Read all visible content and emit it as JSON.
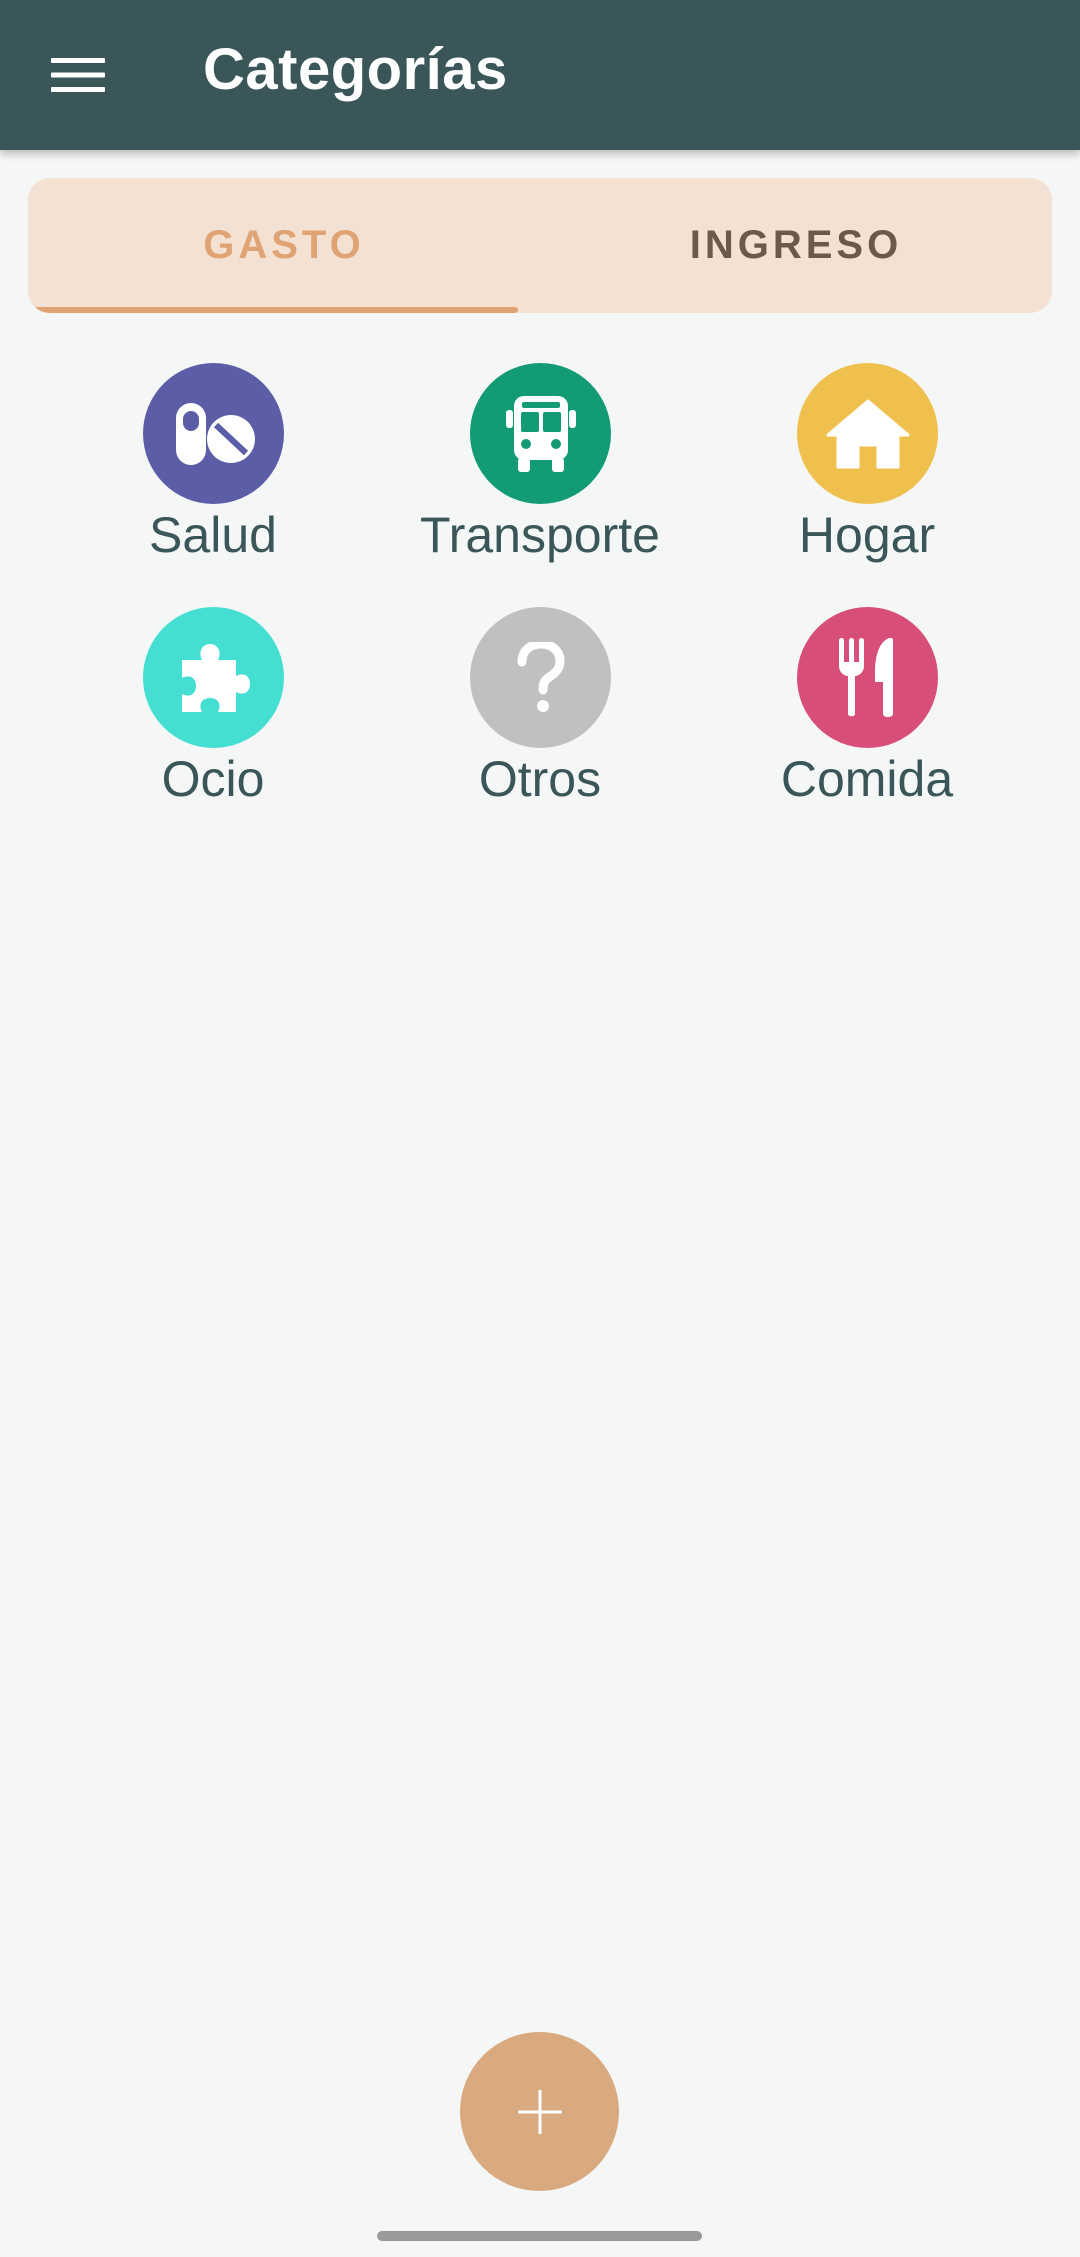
{
  "app_bar": {
    "title": "Categorías",
    "menu_icon": "hamburger-menu-icon",
    "background": "#3a5658"
  },
  "tabs": {
    "items": [
      {
        "label": "GASTO",
        "selected": true,
        "color": "#e0a374"
      },
      {
        "label": "INGRESO",
        "selected": false,
        "color": "#6b5a4c"
      }
    ],
    "background": "#f3e2d3"
  },
  "categories": [
    {
      "label": "Salud",
      "icon": "pills-icon",
      "color": "#5b5ea6"
    },
    {
      "label": "Transporte",
      "icon": "bus-icon",
      "color": "#129b74"
    },
    {
      "label": "Hogar",
      "icon": "house-icon",
      "color": "#f0c04e"
    },
    {
      "label": "Ocio",
      "icon": "puzzle-icon",
      "color": "#44dfd2"
    },
    {
      "label": "Otros",
      "icon": "question-icon",
      "color": "#c0c0c0"
    },
    {
      "label": "Comida",
      "icon": "utensils-icon",
      "color": "#d74f78"
    }
  ],
  "fab": {
    "icon": "plus-icon",
    "color": "#d9aa80"
  }
}
